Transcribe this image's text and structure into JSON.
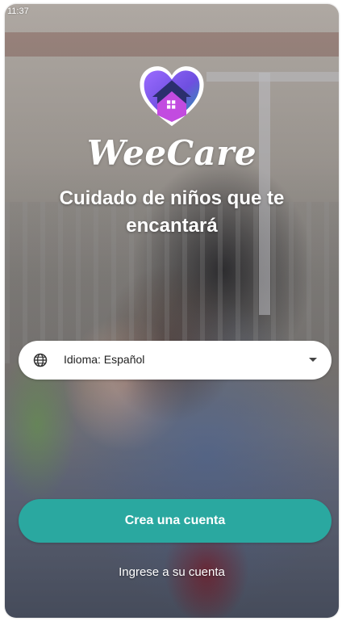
{
  "status_bar": {
    "time": "11:37"
  },
  "brand": {
    "name": "WeeCare",
    "tagline": "Cuidado de niños que te encantará"
  },
  "language_select": {
    "label": "Idioma: Español",
    "icon": "globe-icon"
  },
  "actions": {
    "create_account": "Crea una cuenta",
    "login": "Ingrese a su cuenta"
  },
  "colors": {
    "primary": "#2aa8a0",
    "logo_purple": "#8e3fd6",
    "logo_blue": "#4f6fe0",
    "logo_teal": "#1f9ea0"
  }
}
